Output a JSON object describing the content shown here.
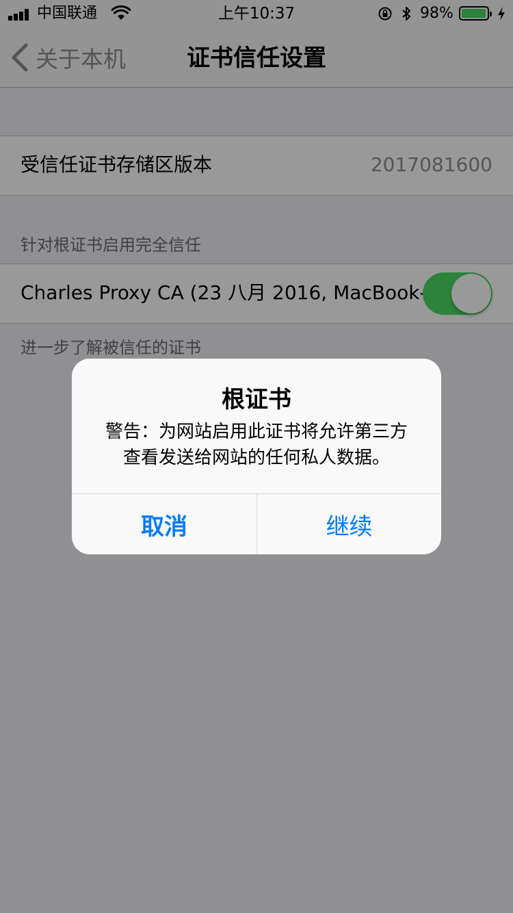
{
  "status_bar": {
    "carrier": "中国联通",
    "time": "上午10:37",
    "battery_percent": "98%",
    "battery_level": 0.98,
    "battery_color": "#4cd964"
  },
  "nav": {
    "back_label": "关于本机",
    "title": "证书信任设置"
  },
  "trust_store": {
    "label": "受信任证书存储区版本",
    "value": "2017081600"
  },
  "full_trust_section": {
    "header": "针对根证书启用完全信任",
    "certificate_label": "Charles Proxy CA (23 八月 2016, MacBook-...",
    "toggle_on": true,
    "toggle_color": "#4cd964",
    "footer": "进一步了解被信任的证书"
  },
  "alert": {
    "title": "根证书",
    "message_line1": "警告：为网站启用此证书将允许第三方",
    "message_line2": "查看发送给网站的任何私人数据。",
    "cancel_label": "取消",
    "continue_label": "继续",
    "button_color": "#007aff"
  }
}
